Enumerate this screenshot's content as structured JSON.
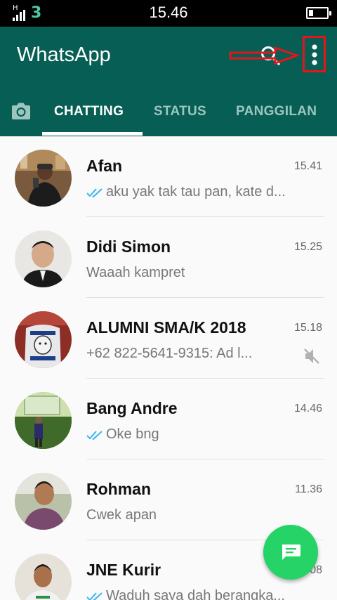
{
  "status_bar": {
    "signal_type": "H",
    "carrier_mark": "3",
    "time": "15.46",
    "battery_level_percent": 25
  },
  "app_bar": {
    "title": "WhatsApp",
    "search_icon": "search-icon",
    "menu_icon": "more-vert-icon",
    "annotation_color": "#e8141a"
  },
  "tabs": [
    {
      "label": "CHATTING",
      "active": true
    },
    {
      "label": "STATUS",
      "active": false
    },
    {
      "label": "PANGGILAN",
      "active": false
    }
  ],
  "chats": [
    {
      "name": "Afan",
      "time": "15.41",
      "preview": "aku yak tak tau pan, kate d...",
      "read_ticks": true,
      "muted": false
    },
    {
      "name": "Didi Simon",
      "time": "15.25",
      "preview": "Waaah kampret",
      "read_ticks": false,
      "muted": false
    },
    {
      "name": "ALUMNI SMA/K 2018",
      "time": "15.18",
      "preview": "+62 822-5641-9315: Ad l...",
      "read_ticks": false,
      "muted": true
    },
    {
      "name": "Bang Andre",
      "time": "14.46",
      "preview": "Oke bng",
      "read_ticks": true,
      "muted": false
    },
    {
      "name": "Rohman",
      "time": "11.36",
      "preview": "Cwek apan",
      "read_ticks": false,
      "muted": false
    },
    {
      "name": "JNE Kurir",
      "time": "08",
      "preview": "Waduh saya dah berangka...",
      "read_ticks": true,
      "muted": false
    }
  ],
  "fab": {
    "icon": "new-chat-icon"
  },
  "colors": {
    "primary": "#075e54",
    "fab": "#25d366",
    "tick_blue": "#34b7f1",
    "annotation": "#e8141a"
  }
}
